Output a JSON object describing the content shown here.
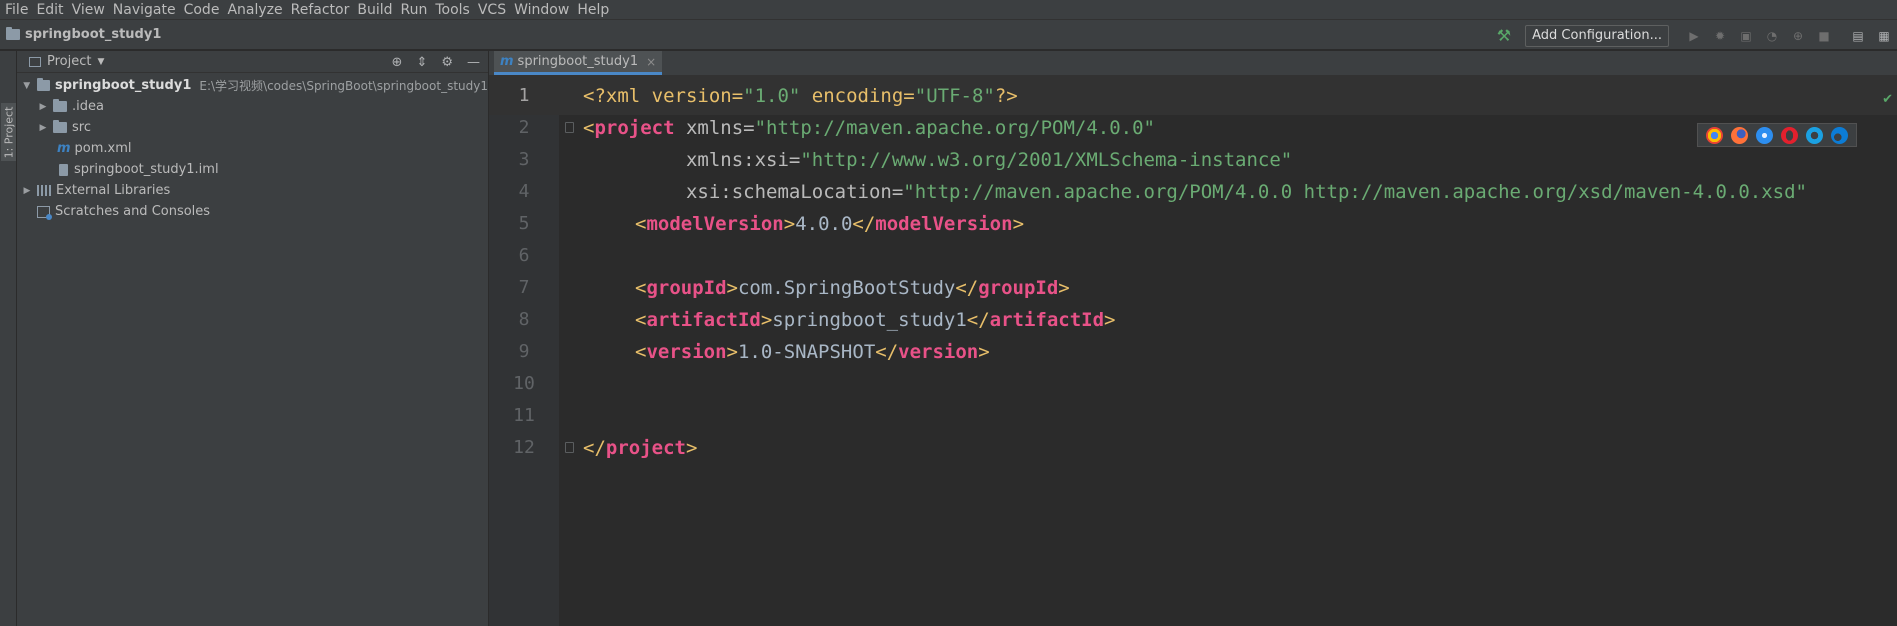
{
  "menu": [
    "File",
    "Edit",
    "View",
    "Navigate",
    "Code",
    "Analyze",
    "Refactor",
    "Build",
    "Run",
    "Tools",
    "VCS",
    "Window",
    "Help"
  ],
  "nav": {
    "project_name": "springboot_study1",
    "add_config": "Add Configuration..."
  },
  "side_tab": "1: Project",
  "project_panel": {
    "title": "Project",
    "root": {
      "name": "springboot_study1",
      "path": "E:\\学习视频\\codes\\SpringBoot\\springboot_study1"
    },
    "items": [
      ".idea",
      "src",
      "pom.xml",
      "springboot_study1.iml"
    ],
    "external": "External Libraries",
    "scratches": "Scratches and Consoles"
  },
  "editor": {
    "tab_label": "springboot_study1",
    "lines": [
      {
        "n": "1"
      },
      {
        "n": "2"
      },
      {
        "n": "3"
      },
      {
        "n": "4"
      },
      {
        "n": "5"
      },
      {
        "n": "6"
      },
      {
        "n": "7"
      },
      {
        "n": "8"
      },
      {
        "n": "9"
      },
      {
        "n": "10"
      },
      {
        "n": "11"
      },
      {
        "n": "12"
      }
    ],
    "code": {
      "l1_a": "<?xml version=",
      "l1_b": "\"1.0\"",
      "l1_c": " encoding=",
      "l1_d": "\"UTF-8\"",
      "l1_e": "?>",
      "l2_a": "<",
      "l2_b": "project",
      "l2_c": " xmlns=",
      "l2_d": "\"http://maven.apache.org/POM/4.0.0\"",
      "l3_a": "         xmlns:xsi=",
      "l3_b": "\"http://www.w3.org/2001/XMLSchema-instance\"",
      "l4_a": "         xsi:schemaLocation=",
      "l4_b": "\"http://maven.apache.org/POM/4.0.0 http://maven.apache.org/xsd/maven-4.0.0.xsd\"",
      "l5_tag": "modelVersion",
      "l5_val": "4.0.0",
      "l7_tag": "groupId",
      "l7_val": "com.SpringBootStudy",
      "l8_tag": "artifactId",
      "l8_val": "springboot_study1",
      "l9_tag": "version",
      "l9_val": "1.0-SNAPSHOT",
      "l12_tag": "project"
    }
  },
  "browsers": [
    "chrome-icon",
    "firefox-icon",
    "safari-icon",
    "opera-icon",
    "ie-icon",
    "edge-icon"
  ],
  "colors": {
    "background": "#2b2b2b",
    "panel": "#3c3f41",
    "tag": "#e85288",
    "string": "#6aab73",
    "accent": "#4a88c7"
  }
}
